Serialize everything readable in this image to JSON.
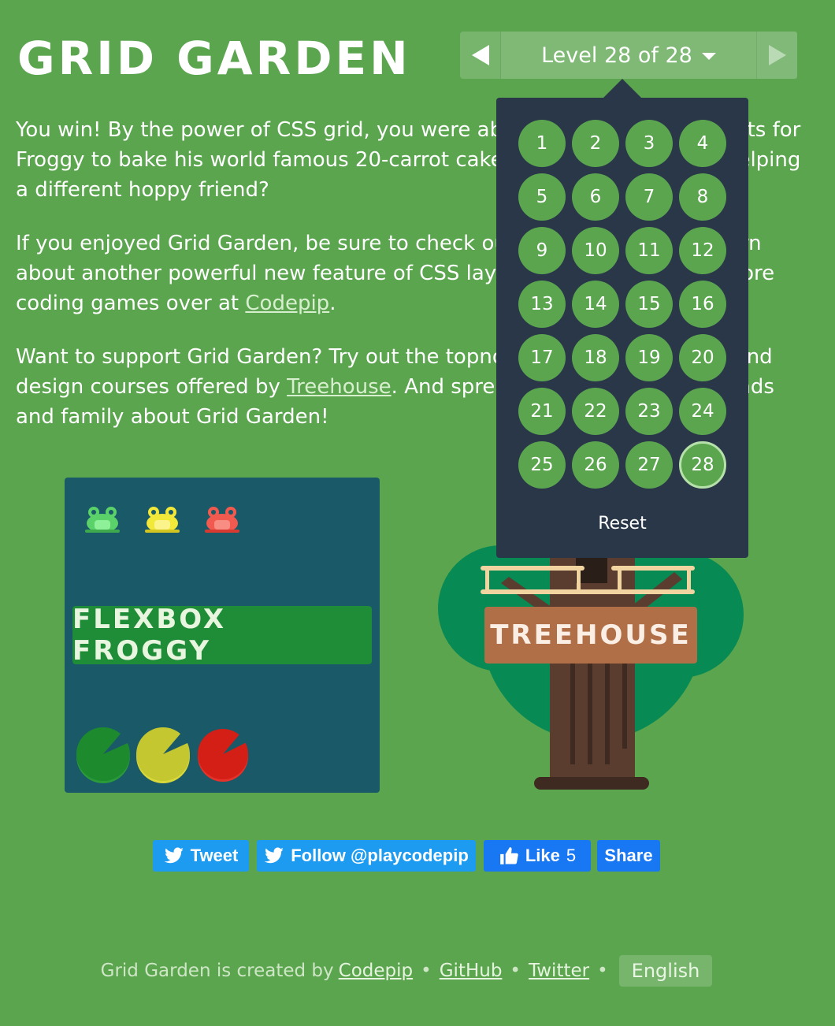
{
  "header": {
    "title": "GRID GARDEN",
    "level_label": "Level 28 of 28"
  },
  "instructions": {
    "p1": "You win! By the power of CSS grid, you were able to grow enough carrots for Froggy to bake his world famous 20-carrot cake. Now, are you up for helping a different hoppy friend?",
    "p2_text": "If you enjoyed Grid Garden, be sure to check out Flexbox Froggy to learn about another powerful new feature of CSS layout. You can also find more coding games over at ",
    "p2_link": "Codepip",
    "p2_end": ".",
    "p3_text": "Want to support Grid Garden? Try out the topnotch web development and design courses offered by ",
    "p3_link": "Treehouse",
    "p3_end": ". And spread the word to your friends and family about Grid Garden!"
  },
  "promo": {
    "froggy_label": "FLEXBOX FROGGY",
    "treehouse_label": "TREEHOUSE"
  },
  "social": {
    "tweet": "Tweet",
    "follow": "Follow @playcodepip",
    "like": "Like",
    "like_count": "5",
    "share": "Share"
  },
  "footer": {
    "created_by": "Grid Garden is created by",
    "codepip": "Codepip",
    "github": "GitHub",
    "twitter": "Twitter",
    "language": "English",
    "sep": "•"
  },
  "levels": {
    "items": [
      "1",
      "2",
      "3",
      "4",
      "5",
      "6",
      "7",
      "8",
      "9",
      "10",
      "11",
      "12",
      "13",
      "14",
      "15",
      "16",
      "17",
      "18",
      "19",
      "20",
      "21",
      "22",
      "23",
      "24",
      "25",
      "26",
      "27",
      "28"
    ],
    "current": "28",
    "reset_label": "Reset"
  },
  "colors": {
    "background": "#5aa54e",
    "dropdown": "#2a3749",
    "froggy_card": "#1a5967",
    "froggy_button": "#1f8c37",
    "treehouse_button": "#b06f47",
    "twitter_blue": "#1d9bf0",
    "facebook_blue": "#1877f2"
  }
}
